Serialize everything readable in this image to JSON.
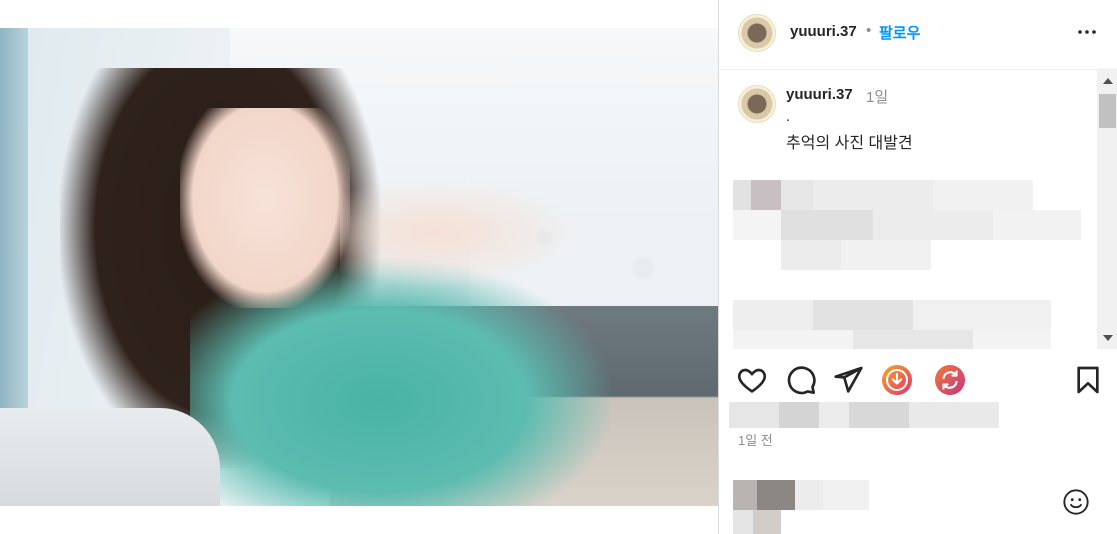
{
  "post": {
    "image_alt": "photo of a woman in a teal patterned dress",
    "header": {
      "username": "yuuuri.37",
      "separator": "•",
      "follow_label": "팔로우",
      "more_icon": "more-horizontal-icon"
    },
    "caption": {
      "username": "yuuuri.37",
      "time": "1일",
      "line1": ".",
      "line2": "추억의 사진 대발견"
    },
    "actions": {
      "like_icon": "heart-icon",
      "comment_icon": "comment-icon",
      "share_icon": "send-icon",
      "download_icon": "download-extension-icon",
      "repost_icon": "repost-extension-icon",
      "save_icon": "bookmark-icon"
    },
    "time_ago": "1일 전",
    "emoji_icon": "smiley-icon"
  },
  "colors": {
    "follow": "#0095f6",
    "text": "#262626",
    "muted": "#8e8e8e",
    "download_gradient": [
      "#f9a825",
      "#e1306c"
    ],
    "repost_gradient": [
      "#f77737",
      "#c13584"
    ]
  }
}
